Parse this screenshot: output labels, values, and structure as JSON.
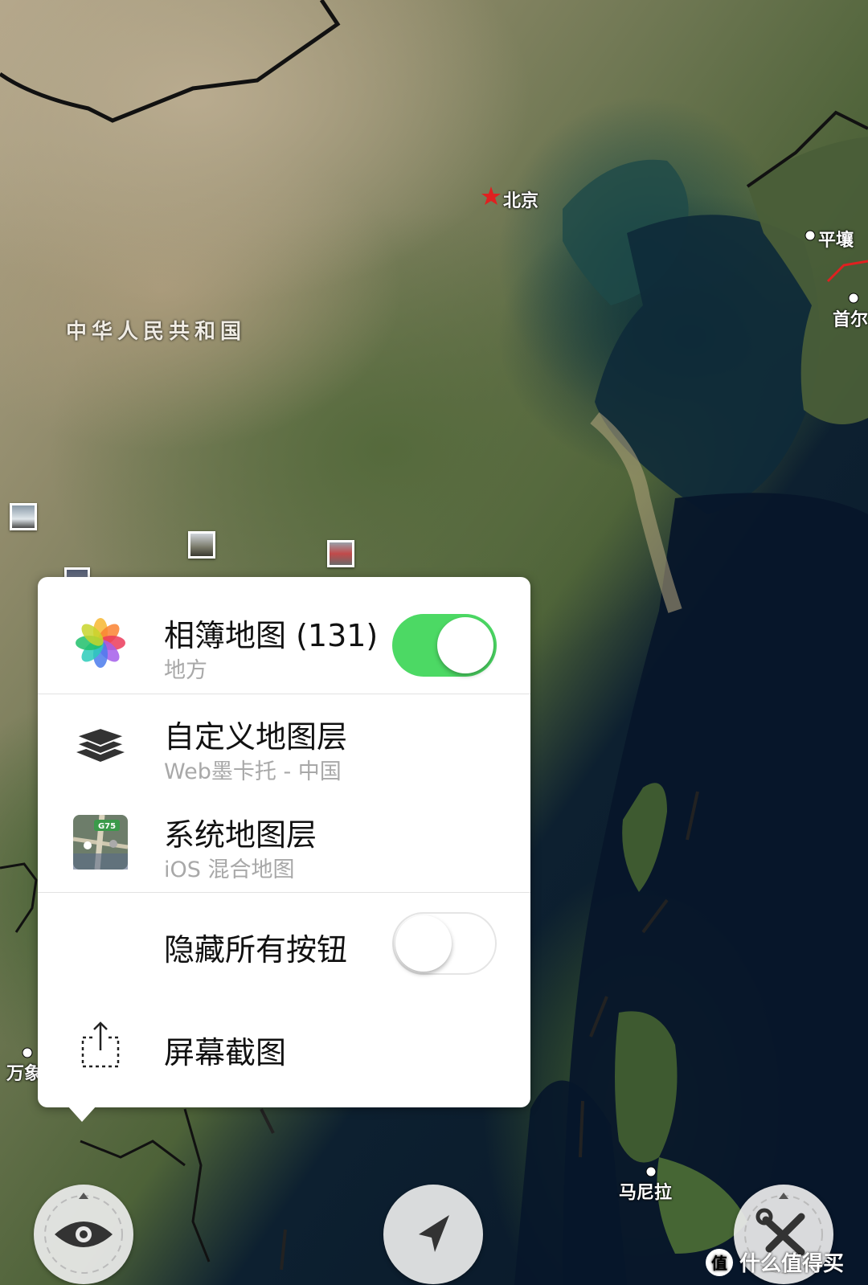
{
  "map": {
    "country_label": "中华人民共和国",
    "cities": {
      "beijing": "北京",
      "pyongyang": "平壤",
      "seoul": "首尔",
      "manila": "马尼拉",
      "vientiane": "万象"
    },
    "capital_star_color": "#e02020",
    "border_color": "#111111"
  },
  "menu": {
    "photos_map": {
      "title": "相簿地图 (131)",
      "subtitle": "地方",
      "icon": "photos-icon",
      "toggle_on": true
    },
    "custom_layer": {
      "title": "自定义地图层",
      "subtitle": "Web墨卡托 - 中国",
      "icon": "layers-icon"
    },
    "system_layer": {
      "title": "系统地图层",
      "subtitle": "iOS 混合地图",
      "icon": "map-icon",
      "icon_badge": "G75"
    },
    "hide_buttons": {
      "title": "隐藏所有按钮",
      "toggle_on": false
    },
    "screenshot": {
      "title": "屏幕截图",
      "icon": "share-icon"
    }
  },
  "controls": {
    "view_button_icon": "eye-icon",
    "locate_button_icon": "location-arrow-icon",
    "tools_button_icon": "tools-icon"
  },
  "watermark": {
    "badge": "值",
    "text": "什么值得买"
  },
  "colors": {
    "toggle_on": "#4cd964",
    "popover_bg": "#ffffff"
  }
}
